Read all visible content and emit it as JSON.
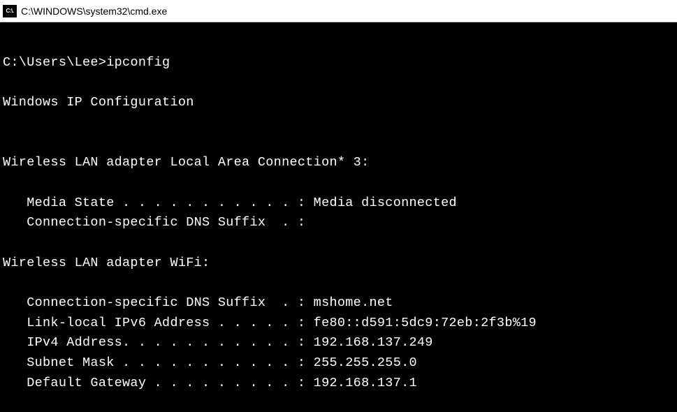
{
  "title_bar": {
    "icon_text": "C:\\.",
    "title": "C:\\WINDOWS\\system32\\cmd.exe"
  },
  "terminal": {
    "prompt": "C:\\Users\\Lee>",
    "command": "ipconfig",
    "header": "Windows IP Configuration",
    "adapter1": {
      "name": "Wireless LAN adapter Local Area Connection* 3:",
      "media_state_line": "   Media State . . . . . . . . . . . : Media disconnected",
      "dns_suffix_line": "   Connection-specific DNS Suffix  . :"
    },
    "adapter2": {
      "name": "Wireless LAN adapter WiFi:",
      "dns_suffix_line": "   Connection-specific DNS Suffix  . : mshome.net",
      "link_local_line": "   Link-local IPv6 Address . . . . . : fe80::d591:5dc9:72eb:2f3b%19",
      "ipv4_line": "   IPv4 Address. . . . . . . . . . . : 192.168.137.249",
      "subnet_line": "   Subnet Mask . . . . . . . . . . . : 255.255.255.0",
      "gateway_line": "   Default Gateway . . . . . . . . . : 192.168.137.1"
    }
  }
}
